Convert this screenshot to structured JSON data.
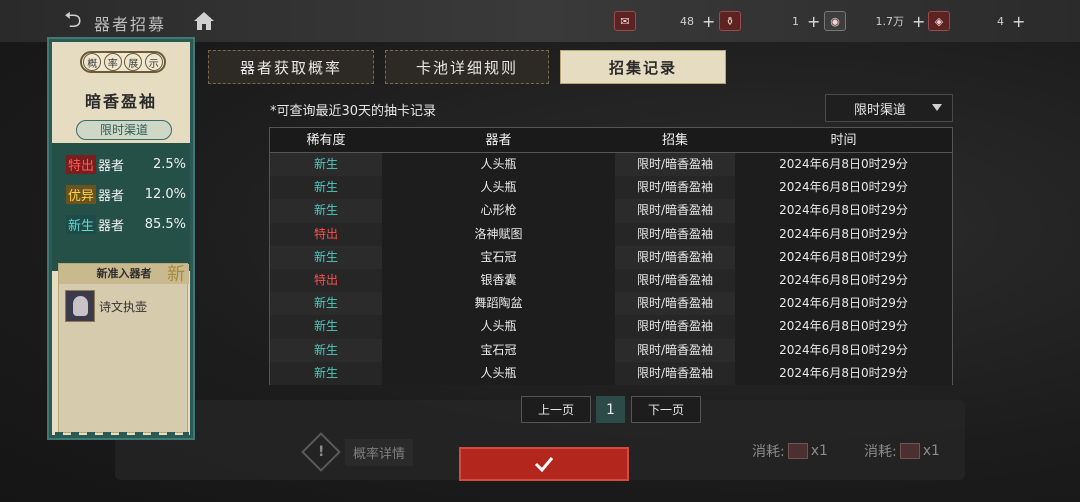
{
  "topbar": {
    "title": "器者招募",
    "resources": [
      {
        "icon": "letter-ticket-icon",
        "value": "48"
      },
      {
        "icon": "pot-ticket-icon",
        "value": "1"
      },
      {
        "icon": "coin-icon",
        "value": "1.7万"
      },
      {
        "icon": "crystal-icon",
        "value": "4"
      }
    ],
    "plus": "+"
  },
  "left_card": {
    "header_chars": [
      "概",
      "率",
      "展",
      "示"
    ],
    "pool_name": "暗香盈袖",
    "channel": "限时渠道",
    "rates": [
      {
        "tag": "特出",
        "kind": "器者",
        "pct": "2.5%",
        "style": "red"
      },
      {
        "tag": "优异",
        "kind": "器者",
        "pct": "12.0%",
        "style": "gold"
      },
      {
        "tag": "新生",
        "kind": "器者",
        "pct": "85.5%",
        "style": "teal"
      }
    ],
    "new_heading": "新准入器者",
    "new_mark": "新",
    "new_item": "诗文执壶"
  },
  "tabs": [
    {
      "label": "器者获取概率"
    },
    {
      "label": "卡池详细规则"
    },
    {
      "label": "招集记录"
    }
  ],
  "hint": "*可查询最近30天的抽卡记录",
  "channel_select": "限时渠道",
  "table": {
    "headers": [
      "稀有度",
      "器者",
      "招集",
      "时间"
    ],
    "rows": [
      {
        "rarity": "新生",
        "item": "人头瓶",
        "pool": "限时/暗香盈袖",
        "time": "2024年6月8日0时29分"
      },
      {
        "rarity": "新生",
        "item": "人头瓶",
        "pool": "限时/暗香盈袖",
        "time": "2024年6月8日0时29分"
      },
      {
        "rarity": "新生",
        "item": "心形枪",
        "pool": "限时/暗香盈袖",
        "time": "2024年6月8日0时29分"
      },
      {
        "rarity": "特出",
        "item": "洛神赋图",
        "pool": "限时/暗香盈袖",
        "time": "2024年6月8日0时29分"
      },
      {
        "rarity": "新生",
        "item": "宝石冠",
        "pool": "限时/暗香盈袖",
        "time": "2024年6月8日0时29分"
      },
      {
        "rarity": "特出",
        "item": "银香囊",
        "pool": "限时/暗香盈袖",
        "time": "2024年6月8日0时29分"
      },
      {
        "rarity": "新生",
        "item": "舞蹈陶盆",
        "pool": "限时/暗香盈袖",
        "time": "2024年6月8日0时29分"
      },
      {
        "rarity": "新生",
        "item": "人头瓶",
        "pool": "限时/暗香盈袖",
        "time": "2024年6月8日0时29分"
      },
      {
        "rarity": "新生",
        "item": "宝石冠",
        "pool": "限时/暗香盈袖",
        "time": "2024年6月8日0时29分"
      },
      {
        "rarity": "新生",
        "item": "人头瓶",
        "pool": "限时/暗香盈袖",
        "time": "2024年6月8日0时29分"
      }
    ]
  },
  "pagination": {
    "prev": "上一页",
    "page": "1",
    "next": "下一页"
  },
  "bottom": {
    "prob_detail": "概率详情",
    "cost_label_1": "消耗:",
    "cost_count_1": "x1",
    "cost_label_2": "消耗:",
    "cost_count_2": "x1"
  },
  "colors": {
    "special": "#ff4d4d",
    "new": "#4fc9c2",
    "accent_red": "#b2261e",
    "teal": "#2b5a55"
  }
}
